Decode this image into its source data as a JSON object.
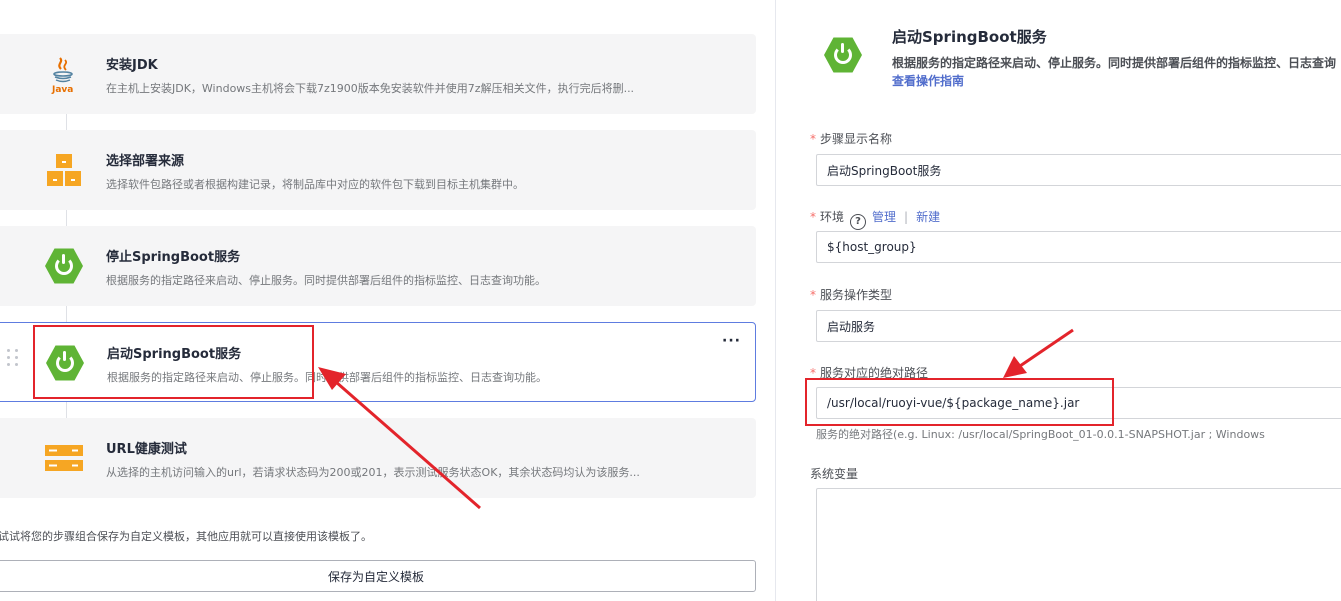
{
  "steps": [
    {
      "title": "安装JDK",
      "desc": "在主机上安装JDK，Windows主机将会下载7z1900版本免安装软件并使用7z解压相关文件，执行完后将删...",
      "icon": "java-icon"
    },
    {
      "title": "选择部署来源",
      "desc": "选择软件包路径或者根据构建记录，将制品库中对应的软件包下载到目标主机集群中。",
      "icon": "package-icon"
    },
    {
      "title": "停止SpringBoot服务",
      "desc": "根据服务的指定路径来启动、停止服务。同时提供部署后组件的指标监控、日志查询功能。",
      "icon": "springboot-icon"
    },
    {
      "title": "启动SpringBoot服务",
      "desc": "根据服务的指定路径来启动、停止服务。同时提供部署后组件的指标监控、日志查询功能。",
      "icon": "springboot-icon"
    },
    {
      "title": "URL健康测试",
      "desc": "从选择的主机访问输入的url，若请求状态码为200或201，表示测试服务状态OK，其余状态码均认为该服务...",
      "icon": "url-health-icon"
    }
  ],
  "active_step_more": "···",
  "template_hint": "试试将您的步骤组合保存为自定义模板，其他应用就可以直接使用该模板了。",
  "save_template_label": "保存为自定义模板",
  "detail": {
    "title": "启动SpringBoot服务",
    "desc": "根据服务的指定路径来启动、停止服务。同时提供部署后组件的指标监控、日志查询",
    "guide_link": "查看操作指南",
    "required_mark": "*",
    "fields": {
      "display_name": {
        "label": "步骤显示名称",
        "value": "启动SpringBoot服务"
      },
      "env": {
        "label": "环境",
        "help": "?",
        "manage": "管理",
        "separator": "|",
        "create": "新建",
        "value": "${host_group}"
      },
      "op_type": {
        "label": "服务操作类型",
        "value": "启动服务"
      },
      "abs_path": {
        "label": "服务对应的绝对路径",
        "value": "/usr/local/ruoyi-vue/${package_name}.jar",
        "hint": "服务的绝对路径(e.g. Linux: /usr/local/SpringBoot_01-0.0.1-SNAPSHOT.jar ; Windows"
      },
      "sys_vars": {
        "label": "系统变量"
      }
    }
  },
  "colors": {
    "accent": "#5e7ce0",
    "link": "#526ecc",
    "annotation": "#e3242b",
    "spring": "#5fb435",
    "package": "#f6a623"
  }
}
